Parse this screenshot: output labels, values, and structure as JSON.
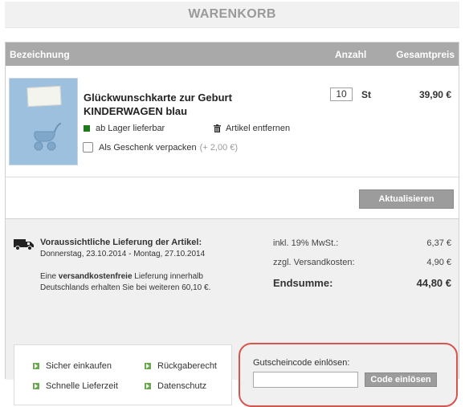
{
  "page": {
    "title": "WARENKORB"
  },
  "cart_header": {
    "name": "Bezeichnung",
    "quantity": "Anzahl",
    "total": "Gesamtpreis"
  },
  "item": {
    "name_line1": "Glückwunschkarte zur Geburt",
    "name_line2": "KINDERWAGEN blau",
    "stock_status": "ab Lager lieferbar",
    "stock_color": "#1c7a1c",
    "remove_label": "Artikel entfernen",
    "remove_icon": "trash-icon",
    "gift_label": "Als Geschenk verpacken",
    "gift_extra": "(+ 2,00 €)",
    "gift_checked": false,
    "quantity": "10",
    "unit": "St",
    "price": "39,90 €"
  },
  "update_button": "Aktualisieren",
  "delivery": {
    "icon": "truck-icon",
    "title": "Voraussichtliche Lieferung der Artikel:",
    "dates": "Donnerstag, 23.10.2014 - Montag, 27.10.2014",
    "info_pre": "Eine ",
    "info_bold": "versandkostenfreie",
    "info_line1_post": " Lieferung innerhalb",
    "info_line2": "Deutschlands erhalten Sie bei weiteren 60,10 €."
  },
  "totals": {
    "vat_label": "inkl. 19% MwSt.:",
    "vat_value": "6,37 €",
    "shipping_label": "zzgl. Versandkosten:",
    "shipping_value": "4,90 €",
    "sum_label": "Endsumme:",
    "sum_value": "44,80 €"
  },
  "trust_links": [
    {
      "label": "Sicher einkaufen"
    },
    {
      "label": "Rückgaberecht"
    },
    {
      "label": "Schnelle Lieferzeit"
    },
    {
      "label": "Datenschutz"
    }
  ],
  "voucher": {
    "label": "Gutscheincode einlösen:",
    "input_value": "",
    "button": "Code einlösen",
    "highlight_color": "#d9534f"
  },
  "colors": {
    "header_bg": "#a9a9a9",
    "button_bg": "#9c9c9c",
    "summary_bg": "#f0f0f0",
    "bullet_green": "#6aa84f"
  }
}
